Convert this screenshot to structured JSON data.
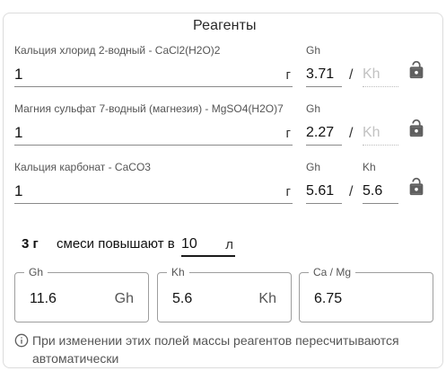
{
  "panel": {
    "title": "Реагенты"
  },
  "labels": {
    "gh": "Gh",
    "kh": "Kh",
    "slash": "/"
  },
  "reagents": [
    {
      "name": "Кальция хлорид 2-водный - CaCl2(H2O)2",
      "mass": "1",
      "unit": "г",
      "gh": "3.71",
      "kh": "",
      "kh_placeholder": "Kh",
      "kh_label": "",
      "lock_icon": "unlock-icon"
    },
    {
      "name": "Магния сульфат 7-водный (магнезия) - MgSO4(H2O)7",
      "mass": "1",
      "unit": "г",
      "gh": "2.27",
      "kh": "",
      "kh_placeholder": "Kh",
      "kh_label": "",
      "lock_icon": "unlock-icon"
    },
    {
      "name": "Кальция карбонат - CaCO3",
      "mass": "1",
      "unit": "г",
      "gh": "5.61",
      "kh": "5.6",
      "kh_placeholder": "",
      "kh_label": "Kh",
      "lock_icon": "unlock-icon"
    }
  ],
  "mix": {
    "amount": "3 г",
    "text": "смеси повышают в",
    "volume": "10",
    "volume_unit": "л"
  },
  "outputs": [
    {
      "label": "Gh",
      "value": "11.6",
      "unit": "Gh"
    },
    {
      "label": "Kh",
      "value": "5.6",
      "unit": "Kh"
    },
    {
      "label": "Ca / Mg",
      "value": "6.75",
      "unit": ""
    }
  ],
  "info": {
    "text": "При изменении этих полей массы реагентов пересчитываются автоматически",
    "icon": "info-icon"
  },
  "colors": {
    "border": "#dcdcdc",
    "text": "#212121",
    "muted": "#555555",
    "placeholder": "#c2c2c2",
    "icon": "#5f5f5f"
  }
}
